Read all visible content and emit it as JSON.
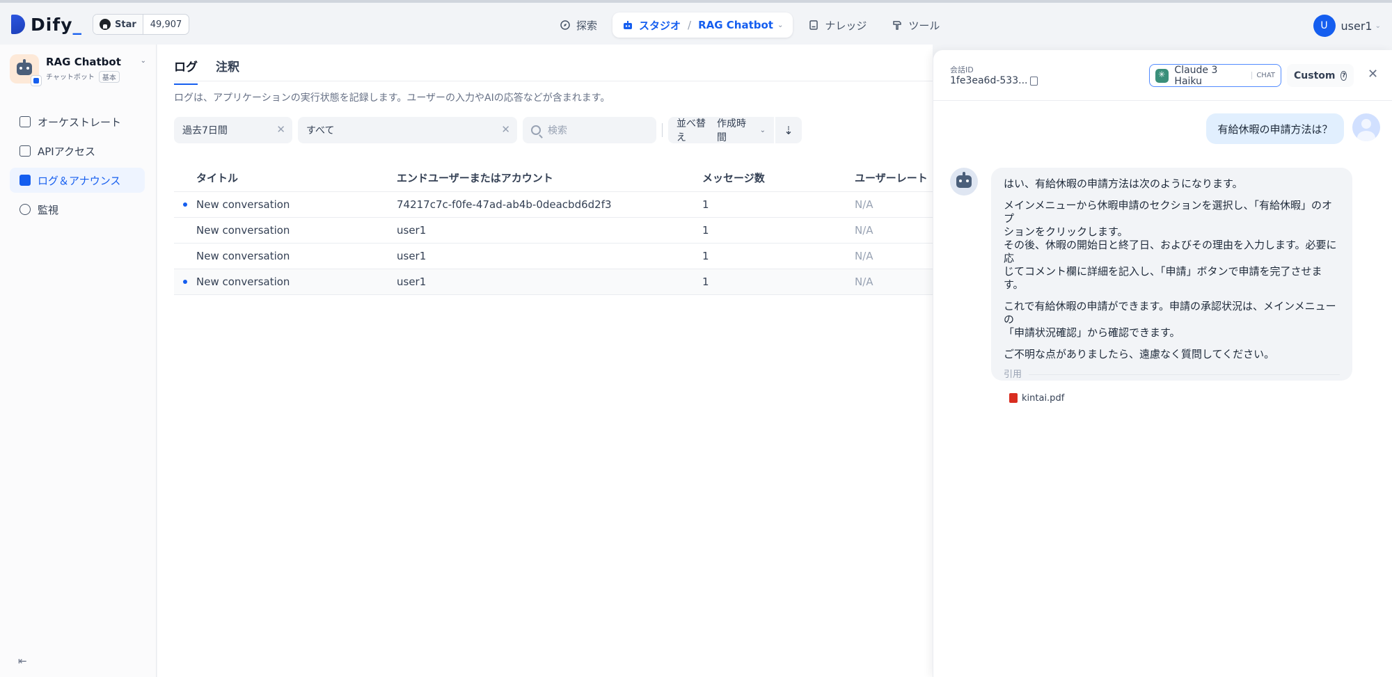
{
  "app": {
    "logo": "Dify",
    "github": {
      "star_label": "Star",
      "count": "49,907"
    },
    "nav": {
      "explore": "探索",
      "studio": "スタジオ",
      "app_name": "RAG Chatbot",
      "knowledge": "ナレッジ",
      "tools": "ツール"
    },
    "user": {
      "initial": "U",
      "name": "user1"
    }
  },
  "sidebar": {
    "app_name": "RAG Chatbot",
    "app_type": "チャットボット",
    "app_mode": "基本",
    "items": [
      {
        "label": "オーケストレート",
        "icon": "terminal-window-icon"
      },
      {
        "label": "APIアクセス",
        "icon": "terminal-icon"
      },
      {
        "label": "ログ＆アナウンス",
        "icon": "file-list-icon"
      },
      {
        "label": "監視",
        "icon": "dashboard-icon"
      }
    ]
  },
  "main": {
    "tabs": [
      "ログ",
      "注釈"
    ],
    "description": "ログは、アプリケーションの実行状態を記録します。ユーザーの入力やAIの応答などが含まれます。",
    "filters": {
      "date": "過去7日間",
      "status": "すべて",
      "search_placeholder": "検索",
      "sort_label": "並べ替え",
      "sort_value": "作成時間"
    },
    "table": {
      "columns": [
        "タイトル",
        "エンドユーザーまたはアカウント",
        "メッセージ数",
        "ユーザーレート"
      ],
      "rows": [
        {
          "title": "New conversation",
          "user": "74217c7c-f0fe-47ad-ab4b-0deacbd6d2f3",
          "messages": "1",
          "rate": "N/A"
        },
        {
          "title": "New conversation",
          "user": "user1",
          "messages": "1",
          "rate": "N/A"
        },
        {
          "title": "New conversation",
          "user": "user1",
          "messages": "1",
          "rate": "N/A"
        },
        {
          "title": "New conversation",
          "user": "user1",
          "messages": "1",
          "rate": "N/A"
        }
      ]
    }
  },
  "drawer": {
    "conversation_id_label": "会話ID",
    "conversation_id": "1fe3ea6d-533...",
    "model": "Claude 3 Haiku",
    "model_mode": "CHAT",
    "custom_label": "Custom",
    "question": "有給休暇の申請方法は？",
    "answer": {
      "p1": "はい、有給休暇の申請方法は次のようになります。",
      "p2a": "メインメニューから休暇申請のセクションを選択し、「有給休暇」のオプ",
      "p2b": "ションをクリックします。",
      "p2c": "その後、休暇の開始日と終了日、およびその理由を入力します。必要に応",
      "p2d": "じてコメント欄に詳細を記入し、「申請」ボタンで申請を完了させます。",
      "p3a": "これで有給休暇の申請ができます。申請の承認状況は、メインメニューの",
      "p3b": "「申請状況確認」から確認できます。",
      "p4": "ご不明な点がありましたら、遠慮なく質問してください。"
    },
    "citation_label": "引用",
    "citation_file": "kintai.pdf"
  },
  "colors": {
    "accent": "#155eef",
    "active_bg": "#eef4ff",
    "question_bg": "#e1effe"
  }
}
